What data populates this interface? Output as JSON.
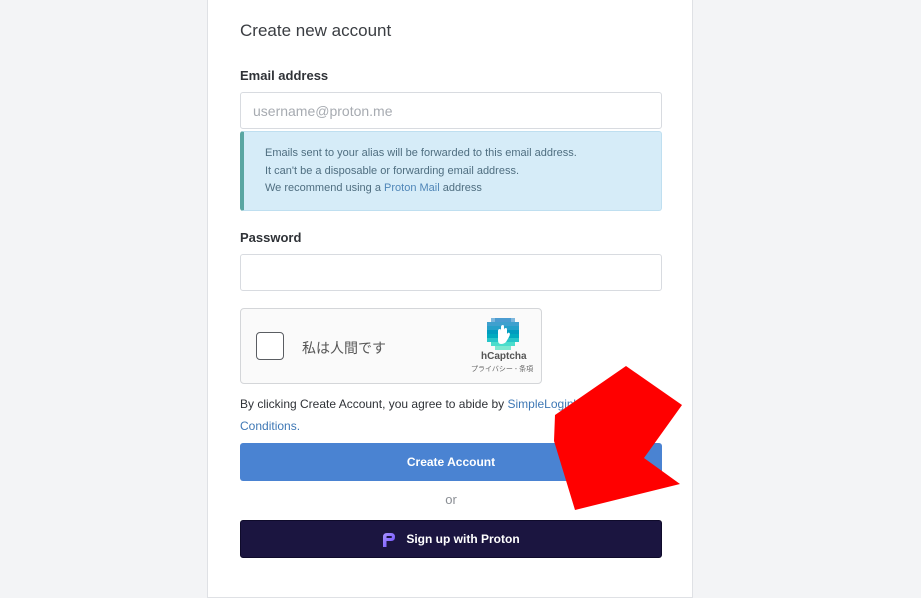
{
  "form": {
    "title": "Create new account",
    "email_label": "Email address",
    "email_placeholder": "username@proton.me",
    "email_value": "",
    "info_line1": "Emails sent to your alias will be forwarded to this email address.",
    "info_line2": "It can't be a disposable or forwarding email address.",
    "info_line3_prefix": "We recommend using a ",
    "info_line3_link": "Proton Mail",
    "info_line3_suffix": " address",
    "password_label": "Password",
    "password_value": "",
    "terms_prefix": "By clicking Create Account, you agree to abide by ",
    "terms_link": "SimpleLogin's Terms and Conditions.",
    "create_button": "Create Account",
    "or_text": "or",
    "proton_button": "Sign up with Proton"
  },
  "captcha": {
    "label": "私は人間です",
    "brand": "hCaptcha",
    "links": "プライバシー - 条項"
  },
  "colors": {
    "create_button": "#4a83d2",
    "proton_button": "#1b1540",
    "info_background": "#d6ecf8",
    "arrow": "#ff0000"
  },
  "icons": {
    "captcha_logo": "hcaptcha-logo",
    "proton_logo": "proton-logo",
    "overlay": "red-arrow"
  }
}
